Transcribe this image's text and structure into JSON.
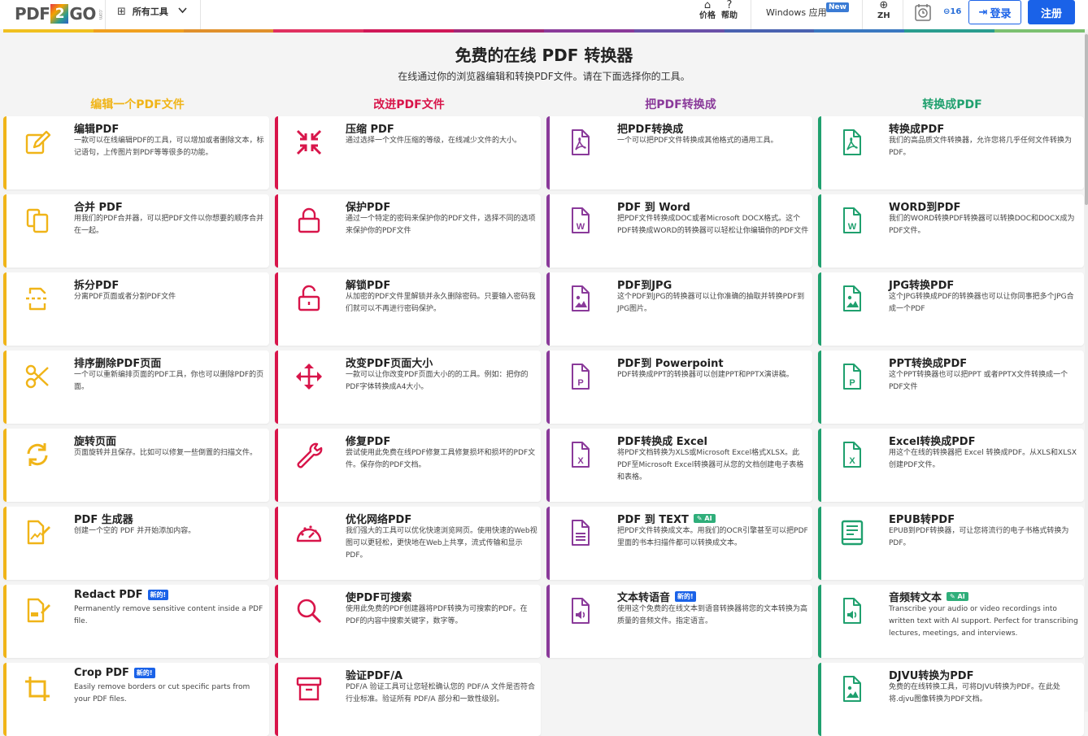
{
  "header": {
    "logo_left": "PDF",
    "logo_num": "2",
    "logo_right": "GO",
    "logo_com": ".com",
    "all_tools": "所有工具",
    "pricing": "价格",
    "help": "帮助",
    "windows_app": "Windows 应用",
    "new_badge": "New",
    "language": "ZH",
    "count": "16",
    "login": "登录",
    "signup": "注册"
  },
  "colorbar": [
    "#f0c020",
    "#f0a020",
    "#e0902c",
    "#e03060",
    "#d01858",
    "#a02878",
    "#8a3a9a",
    "#6a50a8",
    "#4a62b0",
    "#3a78c0",
    "#2a9d8f",
    "#7cc070"
  ],
  "hero": {
    "title": "免费的在线 PDF 转换器",
    "subtitle": "在线通过你的浏览器编辑和转换PDF文件。请在下面选择你的工具。"
  },
  "columns": [
    {
      "heading": "编辑一个PDF文件",
      "color": "#f0b418",
      "cards": [
        {
          "icon": "edit-icon",
          "title": "编辑PDF",
          "desc": "一款可以在线编辑PDF的工具，可以增加或者删除文本，标记语句，上传图片到PDF等等很多的功能。"
        },
        {
          "icon": "merge-icon",
          "title": "合并 PDF",
          "desc": "用我们的PDF合并器，可以把PDF文件以你想要的顺序合并在一起。"
        },
        {
          "icon": "split-icon",
          "title": "拆分PDF",
          "desc": "分离PDF页面或者分割PDF文件"
        },
        {
          "icon": "scissors-icon",
          "title": "排序删除PDF页面",
          "desc": "一个可以重新编排页面的PDF工具，你也可以删除PDF的页面。"
        },
        {
          "icon": "rotate-icon",
          "title": "旋转页面",
          "desc": "页面旋转并且保存。比如可以修复一些倒置的扫描文件。"
        },
        {
          "icon": "generator-icon",
          "title": "PDF 生成器",
          "desc": "创建一个空的 PDF 并开始添加内容。"
        },
        {
          "icon": "redact-icon",
          "title": "Redact PDF",
          "new": "新的!",
          "desc": "Permanently remove sensitive content inside a PDF file."
        },
        {
          "icon": "crop-icon",
          "title": "Crop PDF",
          "new": "新的!",
          "desc": "Easily remove borders or cut specific parts from your PDF files."
        }
      ]
    },
    {
      "heading": "改进PDF文件",
      "color": "#d8154a",
      "cards": [
        {
          "icon": "compress-icon",
          "title": "压缩 PDF",
          "desc": "通过选择一个文件压缩的等级，在线减少文件的大小。"
        },
        {
          "icon": "lock-icon",
          "title": "保护PDF",
          "desc": "通过一个特定的密码来保护你的PDF文件，选择不同的选项来保护你的PDF文件"
        },
        {
          "icon": "unlock-icon",
          "title": "解锁PDF",
          "desc": "从加密的PDF文件里解锁并永久删除密码。只要输入密码我们就可以不再进行密码保护。"
        },
        {
          "icon": "resize-icon",
          "title": "改变PDF页面大小",
          "desc": "一款可以让你改变PDF页面大小的的工具。例如：把你的PDF字体转换成A4大小。"
        },
        {
          "icon": "wrench-icon",
          "title": "修复PDF",
          "desc": "尝试使用此免费在线PDF修复工具修复损坏和损坏的PDF文件。保存你的PDF文档。"
        },
        {
          "icon": "gauge-icon",
          "title": "优化网络PDF",
          "desc": "我们强大的工具可以优化快速浏览网页。使用快速的Web视图可以更轻松，更快地在Web上共享，流式传输和显示PDF。"
        },
        {
          "icon": "search-icon",
          "title": "使PDF可搜索",
          "desc": "使用此免费的PDF创建器将PDF转换为可搜索的PDF。在PDF的内容中搜索关键字，数字等。"
        },
        {
          "icon": "archive-icon",
          "title": "验证PDF/A",
          "desc": "PDF/A 验证工具可让您轻松确认您的 PDF/A 文件是否符合行业标准。验证所有 PDF/A 部分和一致性级别。"
        }
      ]
    },
    {
      "heading": "把PDF转换成",
      "color": "#8a3a9a",
      "cards": [
        {
          "icon": "pdf-file-icon",
          "title": "把PDF转换成",
          "desc": "一个可以把PDF文件转换成其他格式的通用工具。"
        },
        {
          "icon": "word-file-icon",
          "title": "PDF 到 Word",
          "desc": "把PDF文件转换成DOC或者Microsoft DOCX格式。这个PDF转换成WORD的转换器可以轻松让你编辑你的PDF文件"
        },
        {
          "icon": "image-file-icon",
          "title": "PDF到JPG",
          "desc": "这个PDF到JPG的转换器可以让你准确的抽取并转换PDF到JPG图片。"
        },
        {
          "icon": "ppt-file-icon",
          "title": "PDF到 Powerpoint",
          "desc": "PDF转换成PPT的转换器可以创建PPT和PPTX演讲稿。"
        },
        {
          "icon": "excel-file-icon",
          "title": "PDF转换成 Excel",
          "desc": "将PDF文档转换为XLS或Microsoft Excel格式XLSX。此PDF至Microsoft Excel转换器可从您的文档创建电子表格和表格。"
        },
        {
          "icon": "text-file-icon",
          "title": "PDF 到 TEXT",
          "ai": "AI",
          "desc": "把PDF文件转换成文本。用我们的OCR引擎甚至可以把PDF里面的书本扫描件都可以转换成文本。"
        },
        {
          "icon": "audio-file-icon",
          "title": "文本转语音",
          "new": "新的!",
          "desc": "使用这个免费的在线文本到语音转换器将您的文本转换为高质量的音频文件。指定语言。"
        }
      ]
    },
    {
      "heading": "转换成PDF",
      "color": "#1fa06e",
      "cards": [
        {
          "icon": "pdf-file-icon",
          "title": "转换成PDF",
          "desc": "我们的高品质文件转换器，允许您将几乎任何文件转换为PDF。"
        },
        {
          "icon": "word-file-icon",
          "title": "WORD到PDF",
          "desc": "我们的WORD转换PDF转换器可以转换DOC和DOCX成为PDF文件。"
        },
        {
          "icon": "image-file-icon",
          "title": "JPG转换PDF",
          "desc": "这个JPG转换成PDF的转换器也可以让你同事把多个JPG合成一个PDF"
        },
        {
          "icon": "ppt-file-icon",
          "title": "PPT转换成PDF",
          "desc": "这个PPT转换器也可以把PPT 或者PPTX文件转换成一个PDF文件"
        },
        {
          "icon": "excel-file-icon",
          "title": "Excel转换成PDF",
          "desc": "用这个在线的转换器把 Excel 转换成PDF。从XLS和XLSX创建PDF文件。"
        },
        {
          "icon": "ebook-icon",
          "title": "EPUB转PDF",
          "desc": "EPUB到PDF转换器，可让您将流行的电子书格式转换为PDF。"
        },
        {
          "icon": "audio-file-icon",
          "title": "音频转文本",
          "ai": "AI",
          "desc": "Transcribe your audio or video recordings into written text with AI support. Perfect for transcribing lectures, meetings, and interviews."
        },
        {
          "icon": "image-file-icon",
          "title": "DJVU转换为PDF",
          "desc": "免费的在线转换工具，可将DJVU转换为PDF。在此处将.djvu图像转换为PDF文档。"
        }
      ]
    }
  ]
}
